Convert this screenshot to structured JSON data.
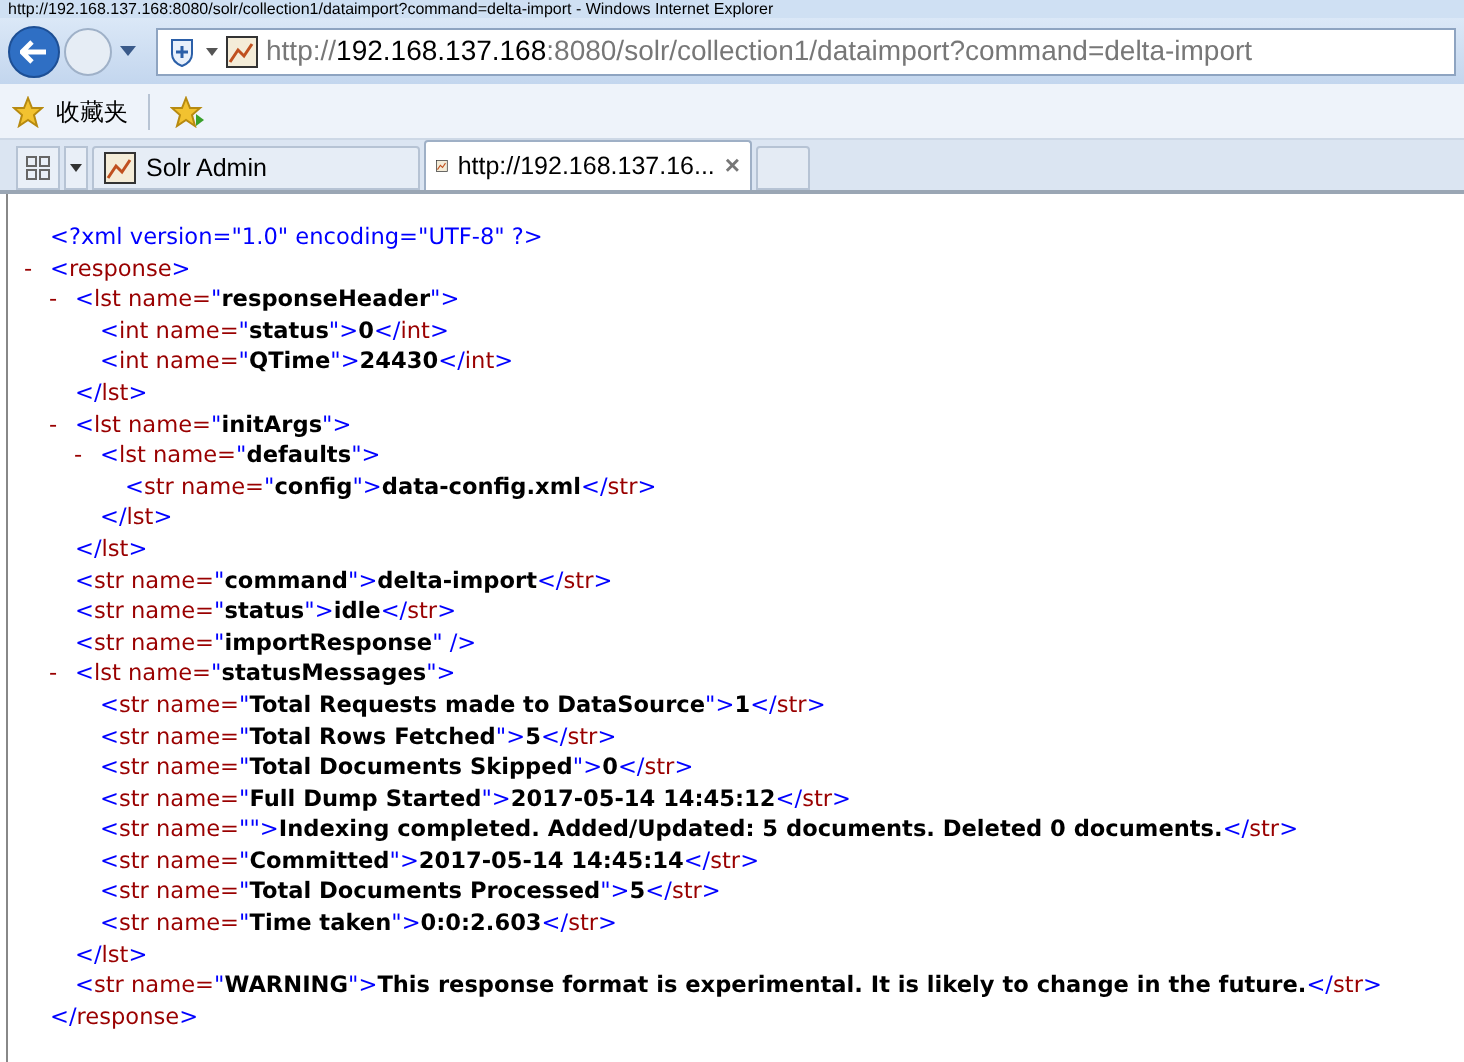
{
  "window": {
    "title": "http://192.168.137.168:8080/solr/collection1/dataimport?command=delta-import - Windows Internet Explorer"
  },
  "address_bar": {
    "parts": [
      {
        "text": "http://",
        "emphasis": false
      },
      {
        "text": "192.168.137.168",
        "emphasis": true
      },
      {
        "text": ":8080/solr/collection1/dataimport?command=delta-import",
        "emphasis": false
      }
    ]
  },
  "favorites_bar": {
    "label": "收藏夹"
  },
  "tabs": [
    {
      "label": "Solr Admin",
      "selected": false
    },
    {
      "label": "http://192.168.137.16...",
      "selected": true,
      "close": "×"
    }
  ],
  "document": [
    {
      "line": [
        {
          "kind": "pi",
          "text": "<?xml version=\"1.0\" encoding=\"UTF-8\" ?>"
        }
      ]
    },
    {
      "toggle": "-",
      "expanded": true,
      "line": [
        {
          "kind": "punct",
          "text": "<"
        },
        {
          "kind": "tag",
          "text": "response"
        },
        {
          "kind": "punct",
          "text": ">"
        }
      ],
      "end": [
        {
          "kind": "punct",
          "text": "</"
        },
        {
          "kind": "tag",
          "text": "response"
        },
        {
          "kind": "punct",
          "text": ">"
        }
      ],
      "children": [
        {
          "toggle": "-",
          "expanded": true,
          "line": [
            {
              "kind": "punct",
              "text": "<"
            },
            {
              "kind": "tag",
              "text": "lst name="
            },
            {
              "kind": "punct",
              "text": "\""
            },
            {
              "kind": "bold",
              "text": "responseHeader"
            },
            {
              "kind": "punct",
              "text": "\">"
            }
          ],
          "end": [
            {
              "kind": "punct",
              "text": "</"
            },
            {
              "kind": "tag",
              "text": "lst"
            },
            {
              "kind": "punct",
              "text": ">"
            }
          ],
          "children": [
            {
              "line": [
                {
                  "kind": "punct",
                  "text": "<"
                },
                {
                  "kind": "tag",
                  "text": "int name="
                },
                {
                  "kind": "punct",
                  "text": "\""
                },
                {
                  "kind": "bold",
                  "text": "status"
                },
                {
                  "kind": "punct",
                  "text": "\">"
                },
                {
                  "kind": "bold",
                  "text": "0"
                },
                {
                  "kind": "punct",
                  "text": "</"
                },
                {
                  "kind": "tag",
                  "text": "int"
                },
                {
                  "kind": "punct",
                  "text": ">"
                }
              ]
            },
            {
              "line": [
                {
                  "kind": "punct",
                  "text": "<"
                },
                {
                  "kind": "tag",
                  "text": "int name="
                },
                {
                  "kind": "punct",
                  "text": "\""
                },
                {
                  "kind": "bold",
                  "text": "QTime"
                },
                {
                  "kind": "punct",
                  "text": "\">"
                },
                {
                  "kind": "bold",
                  "text": "24430"
                },
                {
                  "kind": "punct",
                  "text": "</"
                },
                {
                  "kind": "tag",
                  "text": "int"
                },
                {
                  "kind": "punct",
                  "text": ">"
                }
              ]
            }
          ]
        },
        {
          "toggle": "-",
          "expanded": true,
          "line": [
            {
              "kind": "punct",
              "text": "<"
            },
            {
              "kind": "tag",
              "text": "lst name="
            },
            {
              "kind": "punct",
              "text": "\""
            },
            {
              "kind": "bold",
              "text": "initArgs"
            },
            {
              "kind": "punct",
              "text": "\">"
            }
          ],
          "end": [
            {
              "kind": "punct",
              "text": "</"
            },
            {
              "kind": "tag",
              "text": "lst"
            },
            {
              "kind": "punct",
              "text": ">"
            }
          ],
          "children": [
            {
              "toggle": "-",
              "expanded": true,
              "line": [
                {
                  "kind": "punct",
                  "text": "<"
                },
                {
                  "kind": "tag",
                  "text": "lst name="
                },
                {
                  "kind": "punct",
                  "text": "\""
                },
                {
                  "kind": "bold",
                  "text": "defaults"
                },
                {
                  "kind": "punct",
                  "text": "\">"
                }
              ],
              "end": [
                {
                  "kind": "punct",
                  "text": "</"
                },
                {
                  "kind": "tag",
                  "text": "lst"
                },
                {
                  "kind": "punct",
                  "text": ">"
                }
              ],
              "children": [
                {
                  "line": [
                    {
                      "kind": "punct",
                      "text": "<"
                    },
                    {
                      "kind": "tag",
                      "text": "str name="
                    },
                    {
                      "kind": "punct",
                      "text": "\""
                    },
                    {
                      "kind": "bold",
                      "text": "config"
                    },
                    {
                      "kind": "punct",
                      "text": "\">"
                    },
                    {
                      "kind": "bold",
                      "text": "data-config.xml"
                    },
                    {
                      "kind": "punct",
                      "text": "</"
                    },
                    {
                      "kind": "tag",
                      "text": "str"
                    },
                    {
                      "kind": "punct",
                      "text": ">"
                    }
                  ]
                }
              ]
            }
          ]
        },
        {
          "line": [
            {
              "kind": "punct",
              "text": "<"
            },
            {
              "kind": "tag",
              "text": "str name="
            },
            {
              "kind": "punct",
              "text": "\""
            },
            {
              "kind": "bold",
              "text": "command"
            },
            {
              "kind": "punct",
              "text": "\">"
            },
            {
              "kind": "bold",
              "text": "delta-import"
            },
            {
              "kind": "punct",
              "text": "</"
            },
            {
              "kind": "tag",
              "text": "str"
            },
            {
              "kind": "punct",
              "text": ">"
            }
          ]
        },
        {
          "line": [
            {
              "kind": "punct",
              "text": "<"
            },
            {
              "kind": "tag",
              "text": "str name="
            },
            {
              "kind": "punct",
              "text": "\""
            },
            {
              "kind": "bold",
              "text": "status"
            },
            {
              "kind": "punct",
              "text": "\">"
            },
            {
              "kind": "bold",
              "text": "idle"
            },
            {
              "kind": "punct",
              "text": "</"
            },
            {
              "kind": "tag",
              "text": "str"
            },
            {
              "kind": "punct",
              "text": ">"
            }
          ]
        },
        {
          "line": [
            {
              "kind": "punct",
              "text": "<"
            },
            {
              "kind": "tag",
              "text": "str name="
            },
            {
              "kind": "punct",
              "text": "\""
            },
            {
              "kind": "bold",
              "text": "importResponse"
            },
            {
              "kind": "punct",
              "text": "\" />"
            }
          ]
        },
        {
          "toggle": "-",
          "expanded": true,
          "line": [
            {
              "kind": "punct",
              "text": "<"
            },
            {
              "kind": "tag",
              "text": "lst name="
            },
            {
              "kind": "punct",
              "text": "\""
            },
            {
              "kind": "bold",
              "text": "statusMessages"
            },
            {
              "kind": "punct",
              "text": "\">"
            }
          ],
          "end": [
            {
              "kind": "punct",
              "text": "</"
            },
            {
              "kind": "tag",
              "text": "lst"
            },
            {
              "kind": "punct",
              "text": ">"
            }
          ],
          "children": [
            {
              "line": [
                {
                  "kind": "punct",
                  "text": "<"
                },
                {
                  "kind": "tag",
                  "text": "str name="
                },
                {
                  "kind": "punct",
                  "text": "\""
                },
                {
                  "kind": "bold",
                  "text": "Total Requests made to DataSource"
                },
                {
                  "kind": "punct",
                  "text": "\">"
                },
                {
                  "kind": "bold",
                  "text": "1"
                },
                {
                  "kind": "punct",
                  "text": "</"
                },
                {
                  "kind": "tag",
                  "text": "str"
                },
                {
                  "kind": "punct",
                  "text": ">"
                }
              ]
            },
            {
              "line": [
                {
                  "kind": "punct",
                  "text": "<"
                },
                {
                  "kind": "tag",
                  "text": "str name="
                },
                {
                  "kind": "punct",
                  "text": "\""
                },
                {
                  "kind": "bold",
                  "text": "Total Rows Fetched"
                },
                {
                  "kind": "punct",
                  "text": "\">"
                },
                {
                  "kind": "bold",
                  "text": "5"
                },
                {
                  "kind": "punct",
                  "text": "</"
                },
                {
                  "kind": "tag",
                  "text": "str"
                },
                {
                  "kind": "punct",
                  "text": ">"
                }
              ]
            },
            {
              "line": [
                {
                  "kind": "punct",
                  "text": "<"
                },
                {
                  "kind": "tag",
                  "text": "str name="
                },
                {
                  "kind": "punct",
                  "text": "\""
                },
                {
                  "kind": "bold",
                  "text": "Total Documents Skipped"
                },
                {
                  "kind": "punct",
                  "text": "\">"
                },
                {
                  "kind": "bold",
                  "text": "0"
                },
                {
                  "kind": "punct",
                  "text": "</"
                },
                {
                  "kind": "tag",
                  "text": "str"
                },
                {
                  "kind": "punct",
                  "text": ">"
                }
              ]
            },
            {
              "line": [
                {
                  "kind": "punct",
                  "text": "<"
                },
                {
                  "kind": "tag",
                  "text": "str name="
                },
                {
                  "kind": "punct",
                  "text": "\""
                },
                {
                  "kind": "bold",
                  "text": "Full Dump Started"
                },
                {
                  "kind": "punct",
                  "text": "\">"
                },
                {
                  "kind": "bold",
                  "text": "2017-05-14 14:45:12"
                },
                {
                  "kind": "punct",
                  "text": "</"
                },
                {
                  "kind": "tag",
                  "text": "str"
                },
                {
                  "kind": "punct",
                  "text": ">"
                }
              ]
            },
            {
              "line": [
                {
                  "kind": "punct",
                  "text": "<"
                },
                {
                  "kind": "tag",
                  "text": "str name="
                },
                {
                  "kind": "punct",
                  "text": "\"\">"
                },
                {
                  "kind": "bold",
                  "text": "Indexing completed. Added/Updated: 5 documents. Deleted 0 documents."
                },
                {
                  "kind": "punct",
                  "text": "</"
                },
                {
                  "kind": "tag",
                  "text": "str"
                },
                {
                  "kind": "punct",
                  "text": ">"
                }
              ]
            },
            {
              "line": [
                {
                  "kind": "punct",
                  "text": "<"
                },
                {
                  "kind": "tag",
                  "text": "str name="
                },
                {
                  "kind": "punct",
                  "text": "\""
                },
                {
                  "kind": "bold",
                  "text": "Committed"
                },
                {
                  "kind": "punct",
                  "text": "\">"
                },
                {
                  "kind": "bold",
                  "text": "2017-05-14 14:45:14"
                },
                {
                  "kind": "punct",
                  "text": "</"
                },
                {
                  "kind": "tag",
                  "text": "str"
                },
                {
                  "kind": "punct",
                  "text": ">"
                }
              ]
            },
            {
              "line": [
                {
                  "kind": "punct",
                  "text": "<"
                },
                {
                  "kind": "tag",
                  "text": "str name="
                },
                {
                  "kind": "punct",
                  "text": "\""
                },
                {
                  "kind": "bold",
                  "text": "Total Documents Processed"
                },
                {
                  "kind": "punct",
                  "text": "\">"
                },
                {
                  "kind": "bold",
                  "text": "5"
                },
                {
                  "kind": "punct",
                  "text": "</"
                },
                {
                  "kind": "tag",
                  "text": "str"
                },
                {
                  "kind": "punct",
                  "text": ">"
                }
              ]
            },
            {
              "line": [
                {
                  "kind": "punct",
                  "text": "<"
                },
                {
                  "kind": "tag",
                  "text": "str name="
                },
                {
                  "kind": "punct",
                  "text": "\""
                },
                {
                  "kind": "bold",
                  "text": "Time taken"
                },
                {
                  "kind": "punct",
                  "text": "\">"
                },
                {
                  "kind": "bold",
                  "text": "0:0:2.603"
                },
                {
                  "kind": "punct",
                  "text": "</"
                },
                {
                  "kind": "tag",
                  "text": "str"
                },
                {
                  "kind": "punct",
                  "text": ">"
                }
              ]
            }
          ]
        },
        {
          "line": [
            {
              "kind": "punct",
              "text": "<"
            },
            {
              "kind": "tag",
              "text": "str name="
            },
            {
              "kind": "punct",
              "text": "\""
            },
            {
              "kind": "bold",
              "text": "WARNING"
            },
            {
              "kind": "punct",
              "text": "\">"
            },
            {
              "kind": "bold",
              "text": "This response format is experimental. It is likely to change in the future."
            },
            {
              "kind": "punct",
              "text": "</"
            },
            {
              "kind": "tag",
              "text": "str"
            },
            {
              "kind": "punct",
              "text": ">"
            }
          ]
        }
      ]
    }
  ]
}
